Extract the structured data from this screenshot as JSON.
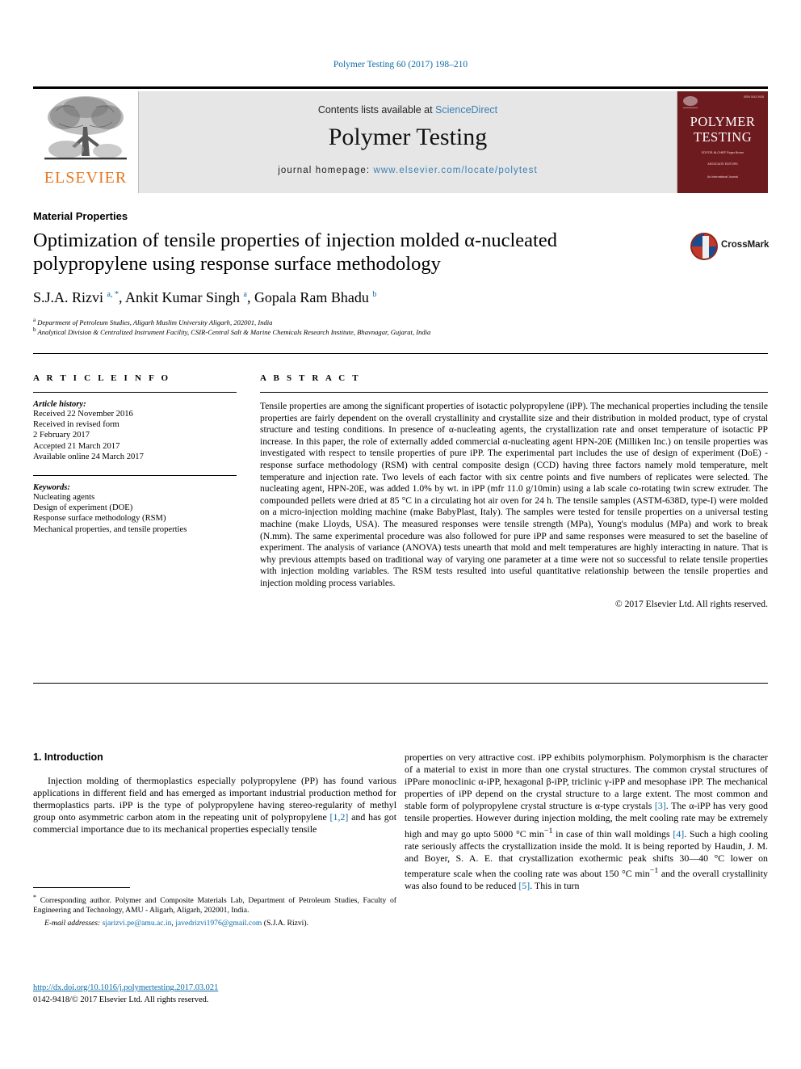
{
  "running_head": "Polymer Testing 60 (2017) 198–210",
  "masthead": {
    "publisher_logo_name": "elsevier-tree-logo",
    "publisher_wordmark": "ELSEVIER",
    "contents_prefix": "Contents lists available at ",
    "contents_link": "ScienceDirect",
    "journal_title": "Polymer Testing",
    "homepage_label": "journal homepage: ",
    "homepage_url": "www.elsevier.com/locate/polytest",
    "cover": {
      "line1": "POLYMER",
      "line2": "TESTING",
      "code": "ISSN 0142-9418",
      "block1": "EDITOR-IN-CHIEF\nRoger Brown",
      "block2": "ASSOCIATE EDITORS",
      "block3": "An International Journal"
    }
  },
  "article": {
    "section_label": "Material Properties",
    "title": "Optimization of tensile properties of injection molded α-nucleated polypropylene using response surface methodology",
    "crossmark_label": "CrossMark",
    "authors_html": "S.J.A. Rizvi <sup>a, *</sup>, Ankit Kumar Singh <sup>a</sup>, Gopala Ram Bhadu <sup>b</sup>",
    "affiliation_a": "Department of Petroleum Studies, Aligarh Muslim University Aligarh, 202001, India",
    "affiliation_b": "Analytical Division & Centralized Instrument Facility, CSIR-Central Salt & Marine Chemicals Research Institute, Bhavnagar, Gujarat, India"
  },
  "article_info": {
    "heading": "A R T I C L E   I N F O",
    "history_label": "Article history:",
    "history": [
      "Received 22 November 2016",
      "Received in revised form",
      "2 February 2017",
      "Accepted 21 March 2017",
      "Available online 24 March 2017"
    ],
    "keywords_label": "Keywords:",
    "keywords": [
      "Nucleating agents",
      "Design of experiment (DOE)",
      "Response surface methodology (RSM)",
      "Mechanical properties, and tensile properties"
    ]
  },
  "abstract": {
    "heading": "A B S T R A C T",
    "text": "Tensile properties are among the significant properties of isotactic polypropylene (iPP). The mechanical properties including the tensile properties are fairly dependent on the overall crystallinity and crystallite size and their distribution in molded product, type of crystal structure and testing conditions. In presence of α-nucleating agents, the crystallization rate and onset temperature of isotactic PP increase. In this paper, the role of externally added commercial α-nucleating agent HPN-20E (Milliken Inc.) on tensile properties was investigated with respect to tensile properties of pure iPP. The experimental part includes the use of design of experiment (DoE) - response surface methodology (RSM) with central composite design (CCD) having three factors namely mold temperature, melt temperature and injection rate. Two levels of each factor with six centre points and five numbers of replicates were selected. The nucleating agent, HPN-20E, was added 1.0% by wt. in iPP (mfr 11.0 g/10min) using a lab scale co-rotating twin screw extruder. The compounded pellets were dried at 85 °C in a circulating hot air oven for 24 h. The tensile samples (ASTM-638D, type-I) were molded on a micro-injection molding machine (make BabyPlast, Italy). The samples were tested for tensile properties on a universal testing machine (make Lloyds, USA). The measured responses were tensile strength (MPa), Young's modulus (MPa) and work to break (N.mm). The same experimental procedure was also followed for pure iPP and same responses were measured to set the baseline of experiment. The analysis of variance (ANOVA) tests unearth that mold and melt temperatures are highly interacting in nature. That is why previous attempts based on traditional way of varying one parameter at a time were not so successful to relate tensile properties with injection molding variables. The RSM tests resulted into useful quantitative relationship between the tensile properties and injection molding process variables.",
    "copyright": "© 2017 Elsevier Ltd. All rights reserved."
  },
  "body": {
    "intro_heading": "1. Introduction",
    "left_paragraph_html": "Injection molding of thermoplastics especially polypropylene (PP) has found various applications in different field and has emerged as important industrial production method for thermoplastics parts. iPP is the type of polypropylene having stereo-regularity of methyl group onto asymmetric carbon atom in the repeating unit of polypropylene <span class=\"ref\">[1,2]</span> and has got commercial importance due to its mechanical properties especially tensile",
    "right_paragraph_html": "properties on very attractive cost. iPP exhibits polymorphism. Polymorphism is the character of a material to exist in more than one crystal structures. The common crystal structures of iPPare monoclinic α-iPP, hexagonal β-iPP, triclinic γ-iPP and mesophase iPP. The mechanical properties of iPP depend on the crystal structure to a large extent. The most common and stable form of polypropylene crystal structure is α-type crystals <span class=\"ref\">[3]</span>. The α-iPP has very good tensile properties. However during injection molding, the melt cooling rate may be extremely high and may go upto 5000 °C min<sup>−1</sup> in case of thin wall moldings <span class=\"ref\">[4]</span>. Such a high cooling rate seriously affects the crystallization inside the mold. It is being reported by Haudin, J. M. and Boyer, S. A. E. that crystallization exothermic peak shifts 30—40 °C lower on temperature scale when the cooling rate was about 150 °C min<sup>−1</sup> and the overall crystallinity was also found to be reduced <span class=\"ref\">[5]</span>. This in turn"
  },
  "footnote": {
    "corresponding_html": "<sup>*</sup> Corresponding author. Polymer and Composite Materials Lab, Department of Petroleum Studies, Faculty of Engineering and Technology, AMU - Aligarh, Aligarh, 202001, India.",
    "email_label": "E-mail addresses: ",
    "email_1": "sjarizvi.pe@amu.ac.in",
    "email_2": "javedrizvi1976@gmail.com",
    "email_attrib": " (S.J.A. Rizvi)."
  },
  "footer": {
    "doi": "http://dx.doi.org/10.1016/j.polymertesting.2017.03.021",
    "issn_line": "0142-9418/© 2017 Elsevier Ltd. All rights reserved."
  }
}
